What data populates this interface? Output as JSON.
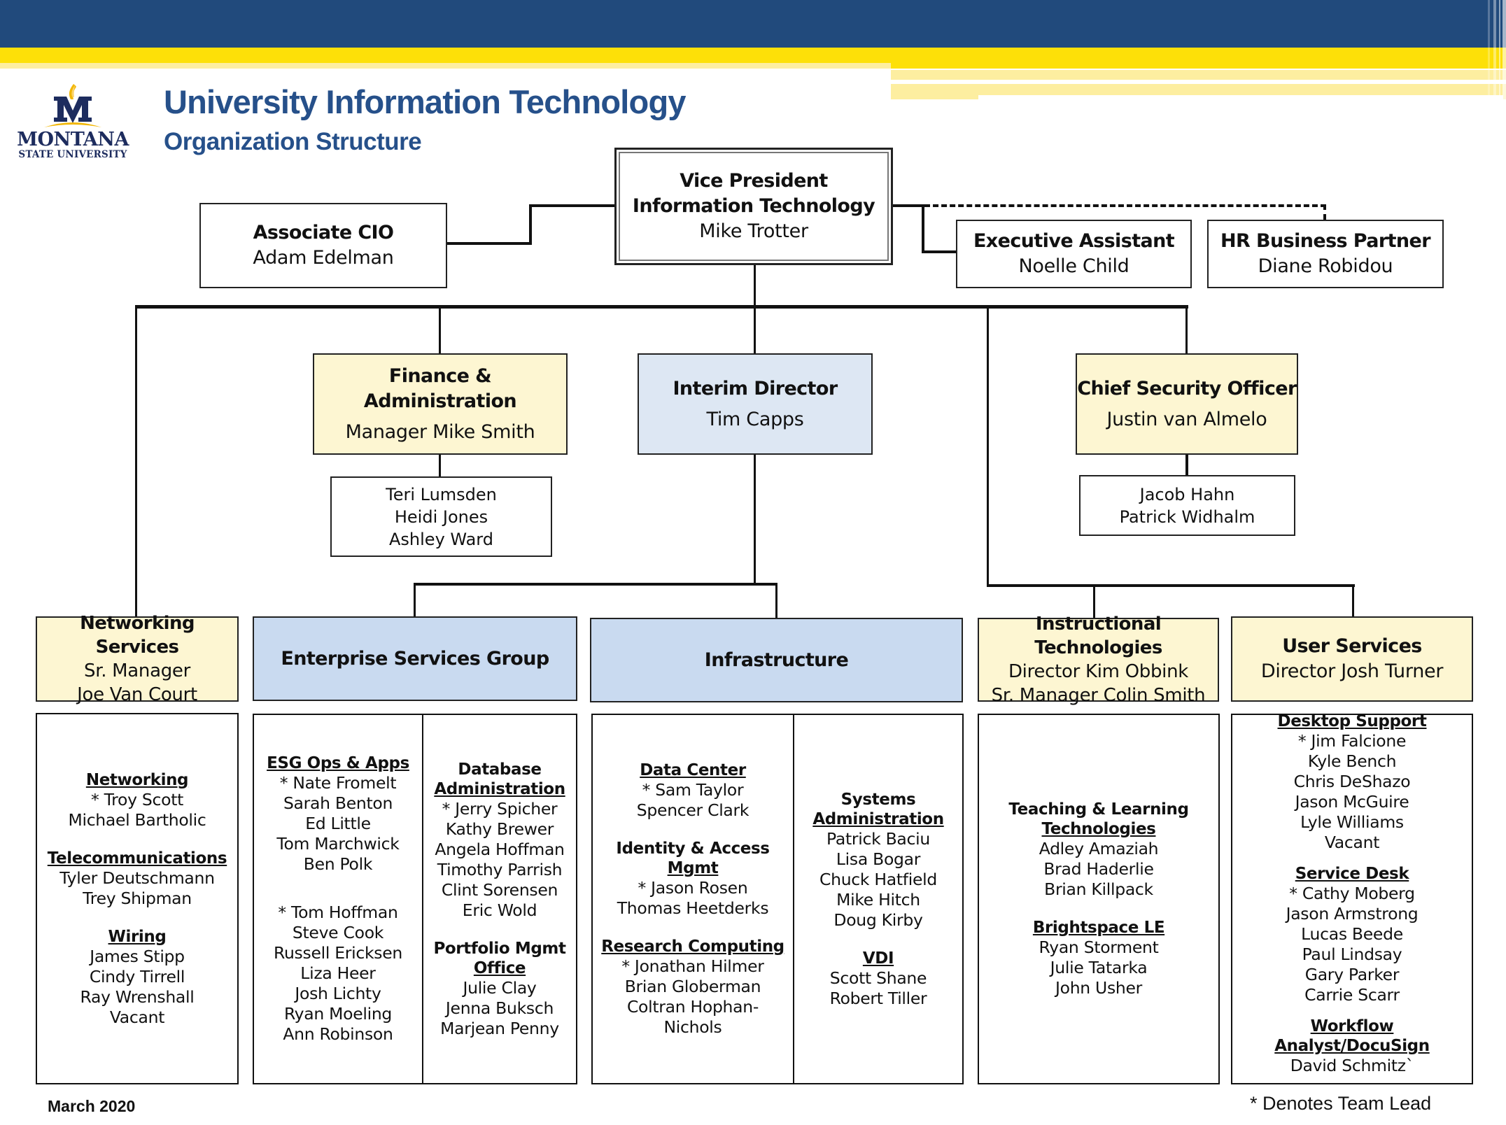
{
  "header": {
    "logo": {
      "icon": "msu-m-flame-logo",
      "word": "MONTANA",
      "sub": "STATE UNIVERSITY"
    },
    "title": "University Information Technology",
    "subtitle": "Organization Structure",
    "colors": {
      "brand_blue": "#214a7c",
      "brand_yellow": "#fde008",
      "title_blue": "#26508a"
    }
  },
  "vp": {
    "title_line1": "Vice President",
    "title_line2": "Information Technology",
    "name": "Mike Trotter"
  },
  "associate_cio": {
    "title": "Associate CIO",
    "name": "Adam Edelman"
  },
  "executive_assistant": {
    "title": "Executive Assistant",
    "name": "Noelle Child"
  },
  "hr_partner": {
    "title": "HR Business Partner",
    "name": "Diane Robidou"
  },
  "finance": {
    "title": "Finance & Administration",
    "name": "Manager Mike Smith",
    "staff": [
      "Teri Lumsden",
      "Heidi Jones",
      "Ashley Ward"
    ]
  },
  "interim_director": {
    "title": "Interim Director",
    "name": "Tim Capps"
  },
  "cso": {
    "title": "Chief Security Officer",
    "name": "Justin van Almelo",
    "staff": [
      "Jacob Hahn",
      "Patrick Widhalm"
    ]
  },
  "units": {
    "networking": {
      "title": "Networking Services",
      "line1": "Sr. Manager",
      "line2": "Joe Van Court"
    },
    "esg": {
      "title": "Enterprise Services Group"
    },
    "infrastructure": {
      "title": "Infrastructure"
    },
    "instructional": {
      "title": "Instructional Technologies",
      "line1": "Director Kim Obbink",
      "line2": "Sr. Manager Colin Smith"
    },
    "user_services": {
      "title": "User Services",
      "line1": "Director Josh Turner"
    }
  },
  "teams": {
    "networking": [
      {
        "head": "Networking",
        "members": [
          "* Troy Scott",
          "Michael Bartholic"
        ]
      },
      {
        "head": "Telecommunications",
        "members": [
          "Tyler Deutschmann",
          "Trey Shipman"
        ]
      },
      {
        "head": "Wiring",
        "members": [
          "James Stipp",
          "Cindy Tirrell",
          "Ray Wrenshall",
          "Vacant"
        ]
      }
    ],
    "esg_left": [
      {
        "head": "ESG Ops & Apps",
        "members": [
          "* Nate Fromelt",
          "Sarah Benton",
          "Ed Little",
          "Tom Marchwick",
          "Ben Polk"
        ]
      },
      {
        "head": "",
        "members": [
          "* Tom Hoffman",
          "Steve Cook",
          "Russell Ericksen",
          "Liza Heer",
          "Josh Lichty",
          "Ryan Moeling",
          "Ann Robinson"
        ]
      }
    ],
    "esg_right": [
      {
        "head_plain": "Database",
        "head": "Administration",
        "members": [
          "* Jerry Spicher",
          "Kathy Brewer",
          "Angela Hoffman",
          "Timothy Parrish",
          "Clint Sorensen",
          "Eric Wold"
        ]
      },
      {
        "head_plain": "Portfolio Mgmt",
        "head": "Office",
        "members": [
          "Julie Clay",
          "Jenna Buksch",
          "Marjean Penny"
        ]
      }
    ],
    "infra_left": [
      {
        "head": "Data Center",
        "members": [
          "* Sam Taylor",
          "Spencer Clark"
        ]
      },
      {
        "head_plain": "Identity & Access",
        "head": "Mgmt",
        "members": [
          "* Jason Rosen",
          "Thomas Heetderks"
        ]
      },
      {
        "head": "Research Computing",
        "members": [
          "* Jonathan Hilmer",
          "Brian Globerman",
          "Coltran Hophan-",
          "Nichols"
        ]
      }
    ],
    "infra_right": [
      {
        "head_plain": "Systems",
        "head": "Administration",
        "members": [
          "Patrick Baciu",
          "Lisa Bogar",
          "Chuck Hatfield",
          "Mike Hitch",
          "Doug Kirby"
        ]
      },
      {
        "head": "VDI",
        "members": [
          "Scott Shane",
          "Robert Tiller"
        ]
      }
    ],
    "instructional": [
      {
        "head_plain": "Teaching & Learning",
        "head": "Technologies",
        "members": [
          "Adley Amaziah",
          "Brad Haderlie",
          "Brian Killpack"
        ]
      },
      {
        "head": "Brightspace LE",
        "members": [
          "Ryan Storment",
          "Julie Tatarka",
          "John Usher"
        ]
      }
    ],
    "user_services": [
      {
        "head": "Desktop Support",
        "members": [
          "* Jim Falcione",
          "Kyle Bench",
          "Chris DeShazo",
          "Jason McGuire",
          "Lyle Williams",
          "Vacant"
        ]
      },
      {
        "head": "Service Desk",
        "members": [
          "* Cathy Moberg",
          "Jason Armstrong",
          "Lucas Beede",
          "Paul Lindsay",
          "Gary Parker",
          "Carrie Scarr"
        ]
      },
      {
        "head": "Workflow Analyst/DocuSign",
        "members": [
          "David Schmitz`"
        ]
      }
    ]
  },
  "footer": {
    "date": "March 2020",
    "legend": "* Denotes Team Lead"
  }
}
